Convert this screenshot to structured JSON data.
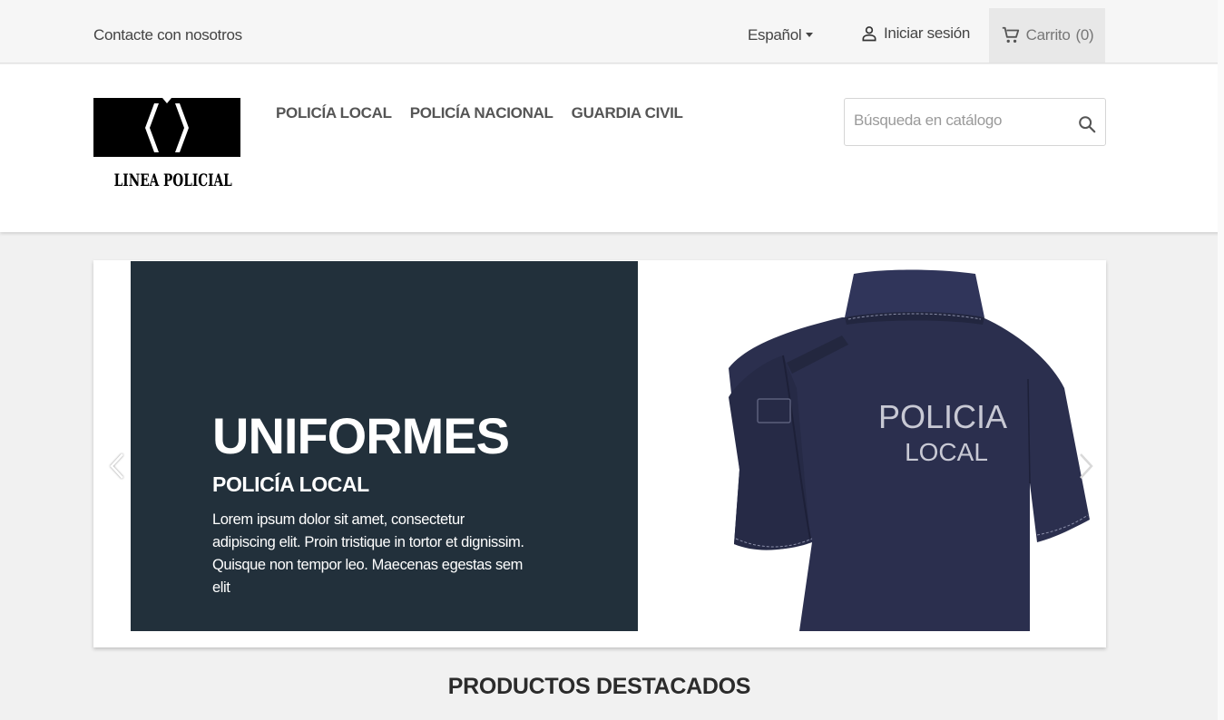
{
  "topbar": {
    "contact": "Contacte con nosotros",
    "language": "Español",
    "sign_in": "Iniciar sesión",
    "cart": "Carrito",
    "cart_count": "(0)"
  },
  "header": {
    "logo_text": "LINEA POLICIAL",
    "nav": [
      "POLICÍA LOCAL",
      "POLICÍA NACIONAL",
      "GUARDIA CIVIL"
    ],
    "search_placeholder": "Búsqueda en catálogo"
  },
  "slider": {
    "title": "UNIFORMES",
    "subtitle": "POLICÍA LOCAL",
    "text": "Lorem ipsum dolor sit amet, consectetur adipiscing elit. Proin tristique in tortor et dignissim. Quisque non tempor leo. Maecenas egestas sem elit",
    "shirt_line1": "POLICIA",
    "shirt_line2": "LOCAL"
  },
  "featured_title": "PRODUCTOS DESTACADOS",
  "colors": {
    "slide_panel": "#22303b",
    "shirt": "#2b2f4e",
    "cart_bg": "#e8e8e8"
  },
  "icons": [
    "person-icon",
    "cart-icon",
    "search-icon",
    "chevron-left-icon",
    "chevron-right-icon",
    "caret-down-icon"
  ]
}
